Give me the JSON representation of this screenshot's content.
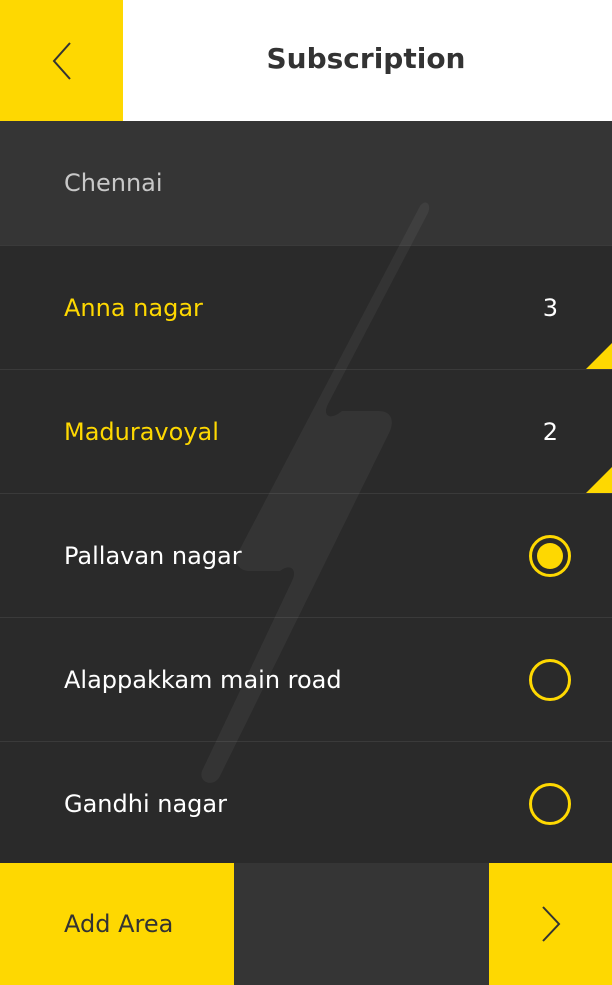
{
  "header": {
    "title": "Subscription",
    "back_icon": "chevron-left-icon"
  },
  "city": {
    "label": "Chennai"
  },
  "areas": [
    {
      "label": "Anna nagar",
      "count": "3",
      "type": "count"
    },
    {
      "label": "Maduravoyal",
      "count": "2",
      "type": "count"
    },
    {
      "label": "Pallavan nagar",
      "type": "radio",
      "selected": true
    },
    {
      "label": "Alappakkam main road",
      "type": "radio",
      "selected": false
    },
    {
      "label": "Gandhi nagar",
      "type": "radio",
      "selected": false
    }
  ],
  "footer": {
    "add_area_label": "Add Area",
    "next_icon": "chevron-right-icon"
  },
  "colors": {
    "accent": "#fed801",
    "background": "#2a2a2a",
    "panel": "#353535",
    "header_bg": "#ffffff"
  }
}
